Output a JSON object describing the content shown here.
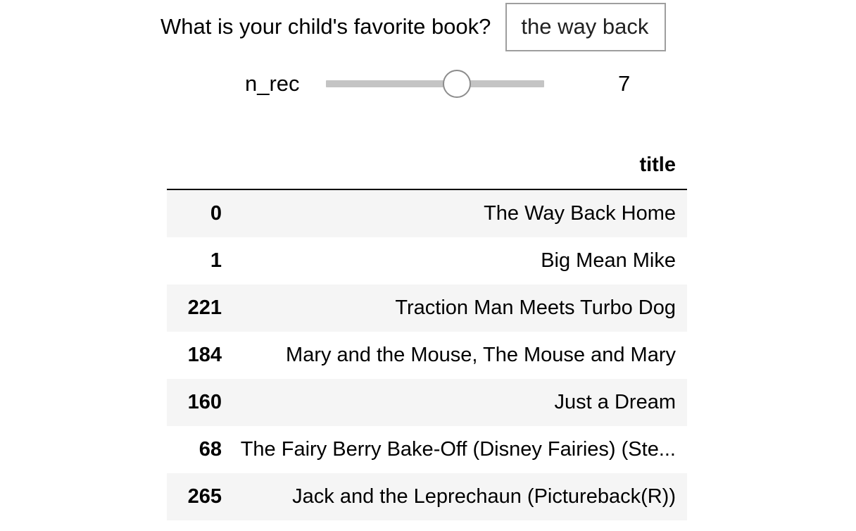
{
  "book_question": {
    "label": "What is your child's favorite book?",
    "value": "the way back home"
  },
  "slider": {
    "label": "n_rec",
    "value": "7",
    "fraction": 0.6
  },
  "table": {
    "column_header": "title",
    "rows": [
      {
        "index": "0",
        "title": "The Way Back Home"
      },
      {
        "index": "1",
        "title": "Big Mean Mike"
      },
      {
        "index": "221",
        "title": "Traction Man Meets Turbo Dog"
      },
      {
        "index": "184",
        "title": "Mary and the Mouse, The Mouse and Mary"
      },
      {
        "index": "160",
        "title": "Just a Dream"
      },
      {
        "index": "68",
        "title": "The Fairy Berry Bake-Off (Disney Fairies) (Ste..."
      },
      {
        "index": "265",
        "title": "Jack and the Leprechaun (Pictureback(R))"
      }
    ]
  }
}
